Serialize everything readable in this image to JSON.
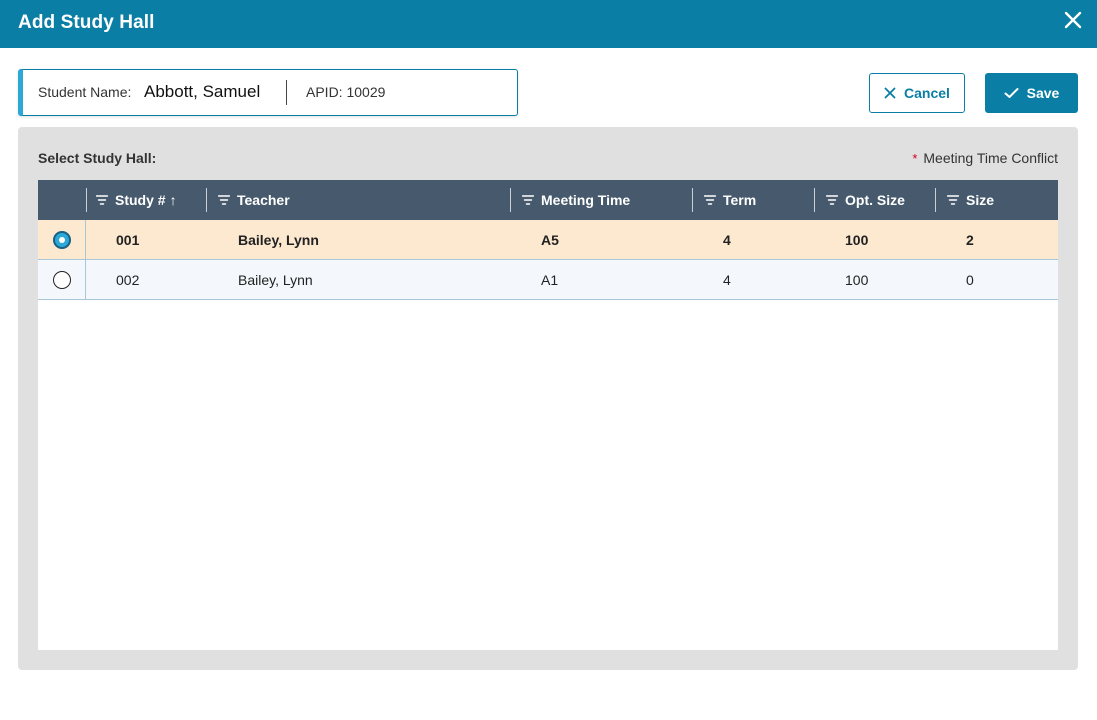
{
  "dialog": {
    "title": "Add Study Hall"
  },
  "student": {
    "name_label": "Student Name:",
    "name": "Abbott, Samuel",
    "apid_label": "APID:",
    "apid": "10029"
  },
  "actions": {
    "cancel_label": "Cancel",
    "save_label": "Save"
  },
  "panel": {
    "select_label": "Select Study Hall:",
    "conflict_marker": "*",
    "conflict_label": "Meeting Time Conflict"
  },
  "table": {
    "columns": [
      {
        "label": "Study #",
        "sort": "↑"
      },
      {
        "label": "Teacher"
      },
      {
        "label": "Meeting Time"
      },
      {
        "label": "Term"
      },
      {
        "label": "Opt. Size"
      },
      {
        "label": "Size"
      }
    ],
    "rows": [
      {
        "selected": true,
        "study": "001",
        "teacher": "Bailey, Lynn",
        "meeting_time": "A5",
        "term": "4",
        "opt_size": "100",
        "size": "2"
      },
      {
        "selected": false,
        "study": "002",
        "teacher": "Bailey, Lynn",
        "meeting_time": "A1",
        "term": "4",
        "opt_size": "100",
        "size": "0"
      }
    ]
  },
  "colors": {
    "header": "#0a7ea4",
    "grid_header": "#475a6d",
    "selected_row": "#fde8d0",
    "accent": "#2aa9d6"
  }
}
